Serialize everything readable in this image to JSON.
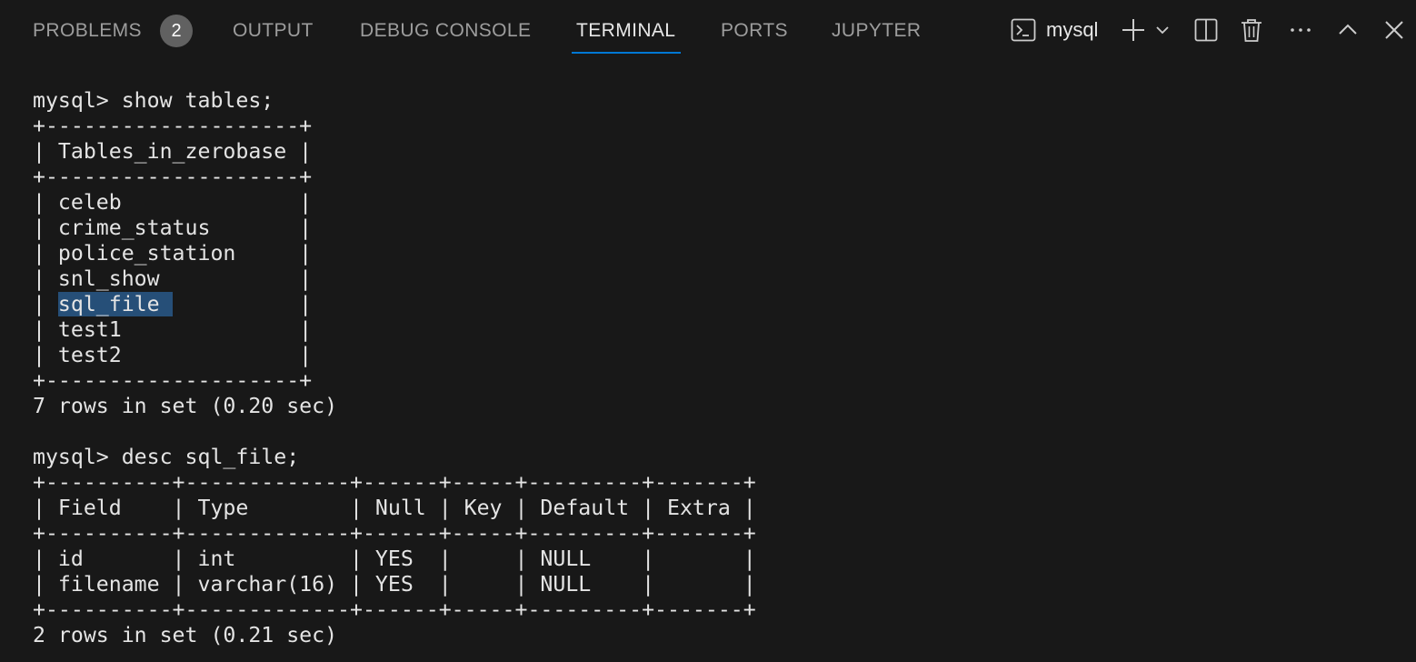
{
  "panel": {
    "tabs": [
      {
        "label": "PROBLEMS",
        "active": false
      },
      {
        "label": "OUTPUT",
        "active": false
      },
      {
        "label": "DEBUG CONSOLE",
        "active": false
      },
      {
        "label": "TERMINAL",
        "active": true
      },
      {
        "label": "PORTS",
        "active": false
      },
      {
        "label": "JUPYTER",
        "active": false
      }
    ],
    "problems_count": "2",
    "terminal_name": "mysql",
    "icons": {
      "terminal": "terminal-icon",
      "add": "plus-icon",
      "dropdown": "chevron-down-icon",
      "split": "split-terminal-icon",
      "kill": "trash-icon",
      "more": "ellipsis-icon",
      "maximize": "chevron-up-icon",
      "close": "close-icon"
    },
    "accent_color": "#0078d4"
  },
  "terminal": {
    "lines": [
      "mysql> show tables;",
      "+--------------------+",
      "| Tables_in_zerobase |",
      "+--------------------+",
      "| celeb              |",
      "| crime_status       |",
      "| police_station     |",
      "| snl_show           |",
      {
        "pre": "| ",
        "sel": "sql_file ",
        "post": "          |"
      },
      "| test1              |",
      "| test2              |",
      "+--------------------+",
      "7 rows in set (0.20 sec)",
      "",
      "mysql> desc sql_file;",
      "+----------+-------------+------+-----+---------+-------+",
      "| Field    | Type        | Null | Key | Default | Extra |",
      "+----------+-------------+------+-----+---------+-------+",
      "| id       | int         | YES  |     | NULL    |       |",
      "| filename | varchar(16) | YES  |     | NULL    |       |",
      "+----------+-------------+------+-----+---------+-------+",
      "2 rows in set (0.21 sec)"
    ],
    "selection_color": "#264f78"
  }
}
